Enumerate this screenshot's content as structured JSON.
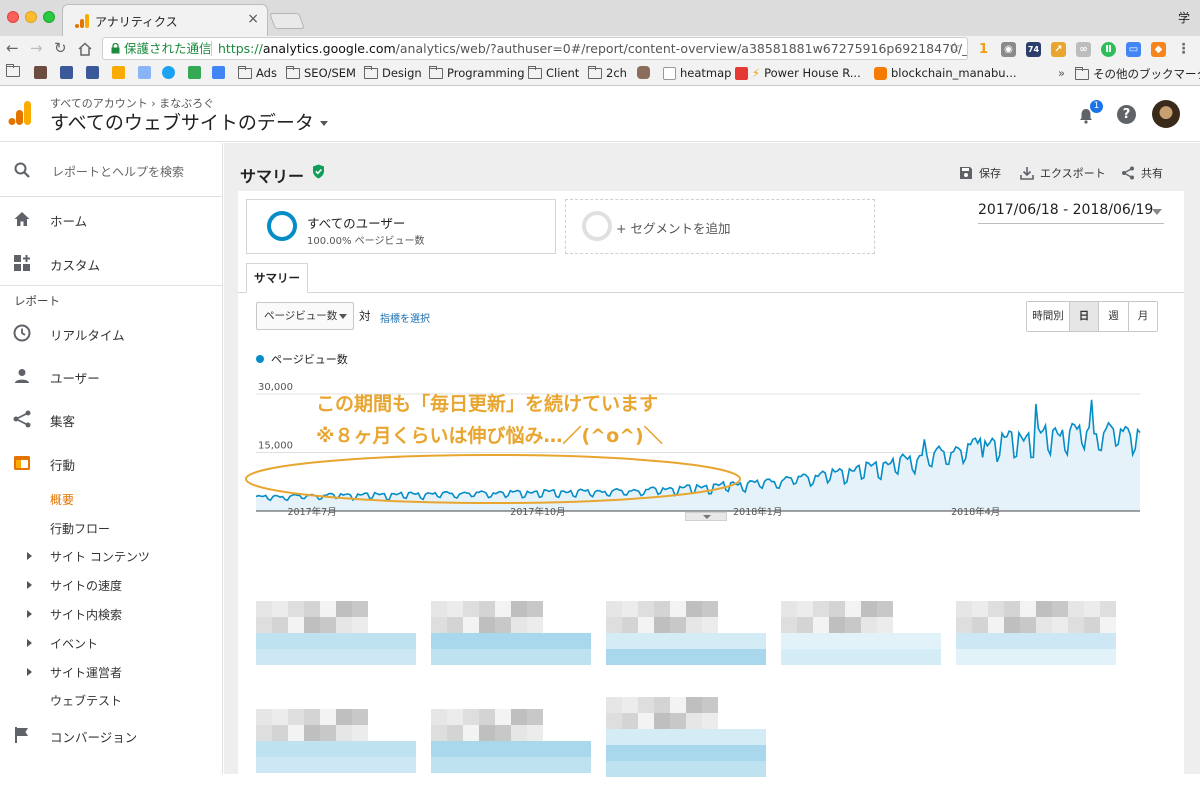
{
  "browser": {
    "tab_title": "アナリティクス",
    "tab_close": "×",
    "profile_char": "学",
    "secure_label": "保護された通信",
    "url_scheme": "https://",
    "url_host": "analytics.google.com",
    "url_path": "/analytics/web/?authuser=0#/report/content-overview/a38581881w67275916p69218470/_u.d...",
    "bookmarks": [
      "Ads",
      "SEO/SEM",
      "Design",
      "Programming",
      "Client",
      "2ch",
      "heatmap",
      "Power House R...",
      "blockchain_manabu...",
      "その他のブックマーク"
    ],
    "ext_badge": "1",
    "ext_count": "74",
    "more_bookmarks": "»"
  },
  "header": {
    "breadcrumb": "すべてのアカウント › まなぶろぐ",
    "property": "すべてのウェブサイトのデータ",
    "notification_count": "1",
    "help": "?"
  },
  "sidebar": {
    "search_placeholder": "レポートとヘルプを検索",
    "home": "ホーム",
    "custom": "カスタム",
    "reports_section": "レポート",
    "realtime": "リアルタイム",
    "audience": "ユーザー",
    "acquisition": "集客",
    "behavior": "行動",
    "behavior_sub": {
      "overview": "概要",
      "flow": "行動フロー",
      "site_content": "サイト コンテンツ",
      "site_speed": "サイトの速度",
      "site_search": "サイト内検索",
      "events": "イベント",
      "publisher": "サイト運営者",
      "experiments": "ウェブテスト"
    },
    "conversions": "コンバージョン"
  },
  "report": {
    "title": "サマリー",
    "save": "保存",
    "export": "エクスポート",
    "share": "共有",
    "segment_name": "すべてのユーザー",
    "segment_sub": "100.00% ページビュー数",
    "add_segment": "+ セグメントを追加",
    "date_range": "2017/06/18 - 2018/06/19",
    "tab": "サマリー",
    "metric": "ページビュー数",
    "vs": "対",
    "choose_metric": "指標を選択",
    "granularity": [
      "時間別",
      "日",
      "週",
      "月"
    ],
    "granularity_selected": "日"
  },
  "annotation": {
    "line1": "この期間も「毎日更新」を続けています",
    "line2": "※８ヶ月くらいは伸び悩み…／(^o^)＼",
    "color": "#e8a530"
  },
  "chart_data": {
    "type": "area",
    "series": [
      {
        "name": "ページビュー数",
        "values": []
      }
    ],
    "x_ticks": [
      "2017年7月",
      "2017年10月",
      "2018年1月",
      "2018年4月"
    ],
    "y_ticks": [
      "30,000",
      "15,000"
    ],
    "ylim": [
      0,
      30000
    ],
    "color": "#058dc7",
    "fill": "#e5f2fa",
    "description_points": {
      "x_start": "2017-06-18",
      "x_end": "2018-06-19",
      "monthly_pageviews_approx": [
        {
          "period": "2017年7月",
          "value": 3500
        },
        {
          "period": "2017年8月",
          "value": 4000
        },
        {
          "period": "2017年9月",
          "value": 4200
        },
        {
          "period": "2017年10月",
          "value": 4500
        },
        {
          "period": "2017年11月",
          "value": 4800
        },
        {
          "period": "2017年12月",
          "value": 5000
        },
        {
          "period": "2018年1月",
          "value": 6000
        },
        {
          "period": "2018年2月",
          "value": 7500
        },
        {
          "period": "2018年3月",
          "value": 10000
        },
        {
          "period": "2018年4月",
          "value": 13500
        },
        {
          "period": "2018年5月",
          "value": 17500
        },
        {
          "period": "2018年6月",
          "value": 20000
        }
      ]
    }
  }
}
